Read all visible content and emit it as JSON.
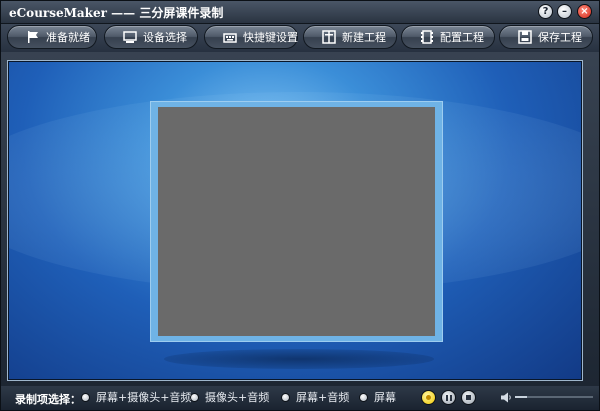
{
  "window": {
    "title": "eCourseMaker —— 三分屏课件录制",
    "help_label": "?",
    "minimize_label": "–",
    "close_label": "×"
  },
  "toolbar": {
    "buttons": [
      {
        "label": "准备就绪",
        "icon": "flag-icon"
      },
      {
        "label": "设备选择",
        "icon": "monitor-icon"
      },
      {
        "label": "快捷键设置",
        "icon": "keyboard-icon"
      },
      {
        "label": "新建工程",
        "icon": "new-project-icon"
      },
      {
        "label": "配置工程",
        "icon": "film-config-icon"
      },
      {
        "label": "保存工程",
        "icon": "save-icon"
      }
    ]
  },
  "bottombar": {
    "record_label": "录制项选择：",
    "options": [
      {
        "label": "屏幕+摄像头+音频"
      },
      {
        "label": "摄像头+音频"
      },
      {
        "label": "屏幕+音频"
      },
      {
        "label": "屏幕"
      }
    ],
    "volume_level": 0.15
  },
  "colors": {
    "stage_top": "#7fc3f3",
    "stage_bottom": "#123a86",
    "screen": "#6a6a6a",
    "record_button": "#f0c800"
  }
}
